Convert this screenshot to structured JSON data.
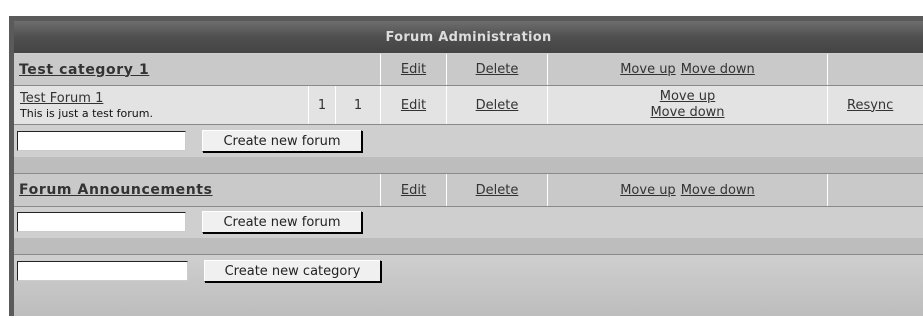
{
  "header": {
    "title": "Forum Administration"
  },
  "categories": [
    {
      "title": "Test category 1",
      "edit": "Edit",
      "delete": "Delete",
      "move_up": "Move up",
      "move_down": "Move down",
      "forum": {
        "name": "Test Forum 1",
        "description": "This is just a test forum.",
        "topics": "1",
        "posts": "1",
        "edit": "Edit",
        "delete": "Delete",
        "move_up": "Move up",
        "move_down": "Move down",
        "resync": "Resync"
      },
      "create_forum_button": "Create new forum",
      "create_forum_value": ""
    },
    {
      "title": "Forum Announcements",
      "edit": "Edit",
      "delete": "Delete",
      "move_up": "Move up",
      "move_down": "Move down",
      "create_forum_button": "Create new forum",
      "create_forum_value": ""
    }
  ],
  "create_category": {
    "button": "Create new category",
    "value": ""
  }
}
